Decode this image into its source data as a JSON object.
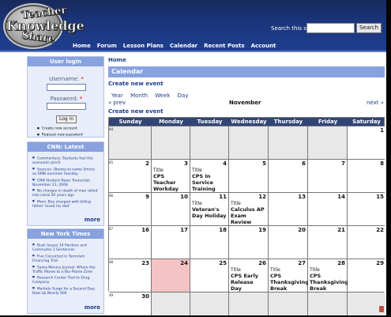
{
  "logo": {
    "line1": "Teacher",
    "line2": "Knowledge",
    "line3": "Share"
  },
  "search": {
    "label": "Search this site:",
    "button": "Search"
  },
  "nav": [
    "Home",
    "Forum",
    "Lesson Plans",
    "Calendar",
    "Recent Posts",
    "Account"
  ],
  "login": {
    "title": "User login",
    "username_label": "Username:",
    "password_label": "Password:",
    "required": "*",
    "button": "Log in",
    "links": [
      "Create new account",
      "Request new password"
    ]
  },
  "cnn": {
    "title": "CNN: Latest",
    "items": [
      "Commentary: Students feel the economic pinch",
      "Sources: Obama to name Emory as OMB nominee Tuesday",
      "CNN Student News Transcript: November 21, 2008",
      "No charges in death of man rolled into canal 20 years ago",
      "Mom: Boy charged with killing father 'loved his dad'"
    ],
    "more": "more"
  },
  "nyt": {
    "title": "New York Times",
    "items": [
      "Bush Issues 14 Pardons and Commutes 2 Sentences",
      "Five Convicted in Terrorism Financing Trial",
      "Santa Monica Journal: Where the Traffic Moves to a Bio-Plaine Zone",
      "Research Center Tied to Drug Company",
      "Markets Surge for a Second Day; Dow Up Nearly 400"
    ],
    "more": "more"
  },
  "content": {
    "crumb": "Home",
    "title": "Calendar",
    "create": "Create new event",
    "views": [
      "Year",
      "Month",
      "Week",
      "Day"
    ],
    "prev": "« prev",
    "month": "November",
    "next": "next »",
    "create2": "Create new event"
  },
  "calendar": {
    "days": [
      "Sunday",
      "Monday",
      "Tuesday",
      "Wednesday",
      "Thursday",
      "Friday",
      "Saturday"
    ],
    "weeks": [
      {
        "no": "44",
        "days": [
          "",
          "",
          "",
          "",
          "",
          "",
          "1"
        ]
      },
      {
        "no": "45",
        "days": [
          "2",
          "3",
          "4",
          "5",
          "6",
          "7",
          "8"
        ]
      },
      {
        "no": "46",
        "days": [
          "9",
          "10",
          "11",
          "12",
          "13",
          "14",
          "15"
        ]
      },
      {
        "no": "47",
        "days": [
          "16",
          "17",
          "18",
          "19",
          "20",
          "21",
          "22"
        ]
      },
      {
        "no": "48",
        "days": [
          "23",
          "24",
          "25",
          "26",
          "27",
          "28",
          "29"
        ]
      },
      {
        "no": "49",
        "days": [
          "30",
          "",
          "",
          "",
          "",
          "",
          ""
        ]
      }
    ],
    "events": {
      "1-1": {
        "title": "Title",
        "name": "CPS Teacher Workday"
      },
      "1-2": {
        "title": "Title",
        "name": "CPS In Service Training Day for Personnel"
      },
      "2-2": {
        "title": "Title",
        "name": "Veteran's Day Holiday"
      },
      "2-3": {
        "title": "Title",
        "name": "Calculus AP Exam Review"
      },
      "4-3": {
        "title": "Title",
        "name": "CPS Early Release Day"
      },
      "4-4": {
        "title": "Title",
        "name": "CPS Thanksgiving Break"
      },
      "4-5": {
        "title": "Title",
        "name": "CPS Thanksgiving Break"
      }
    }
  }
}
